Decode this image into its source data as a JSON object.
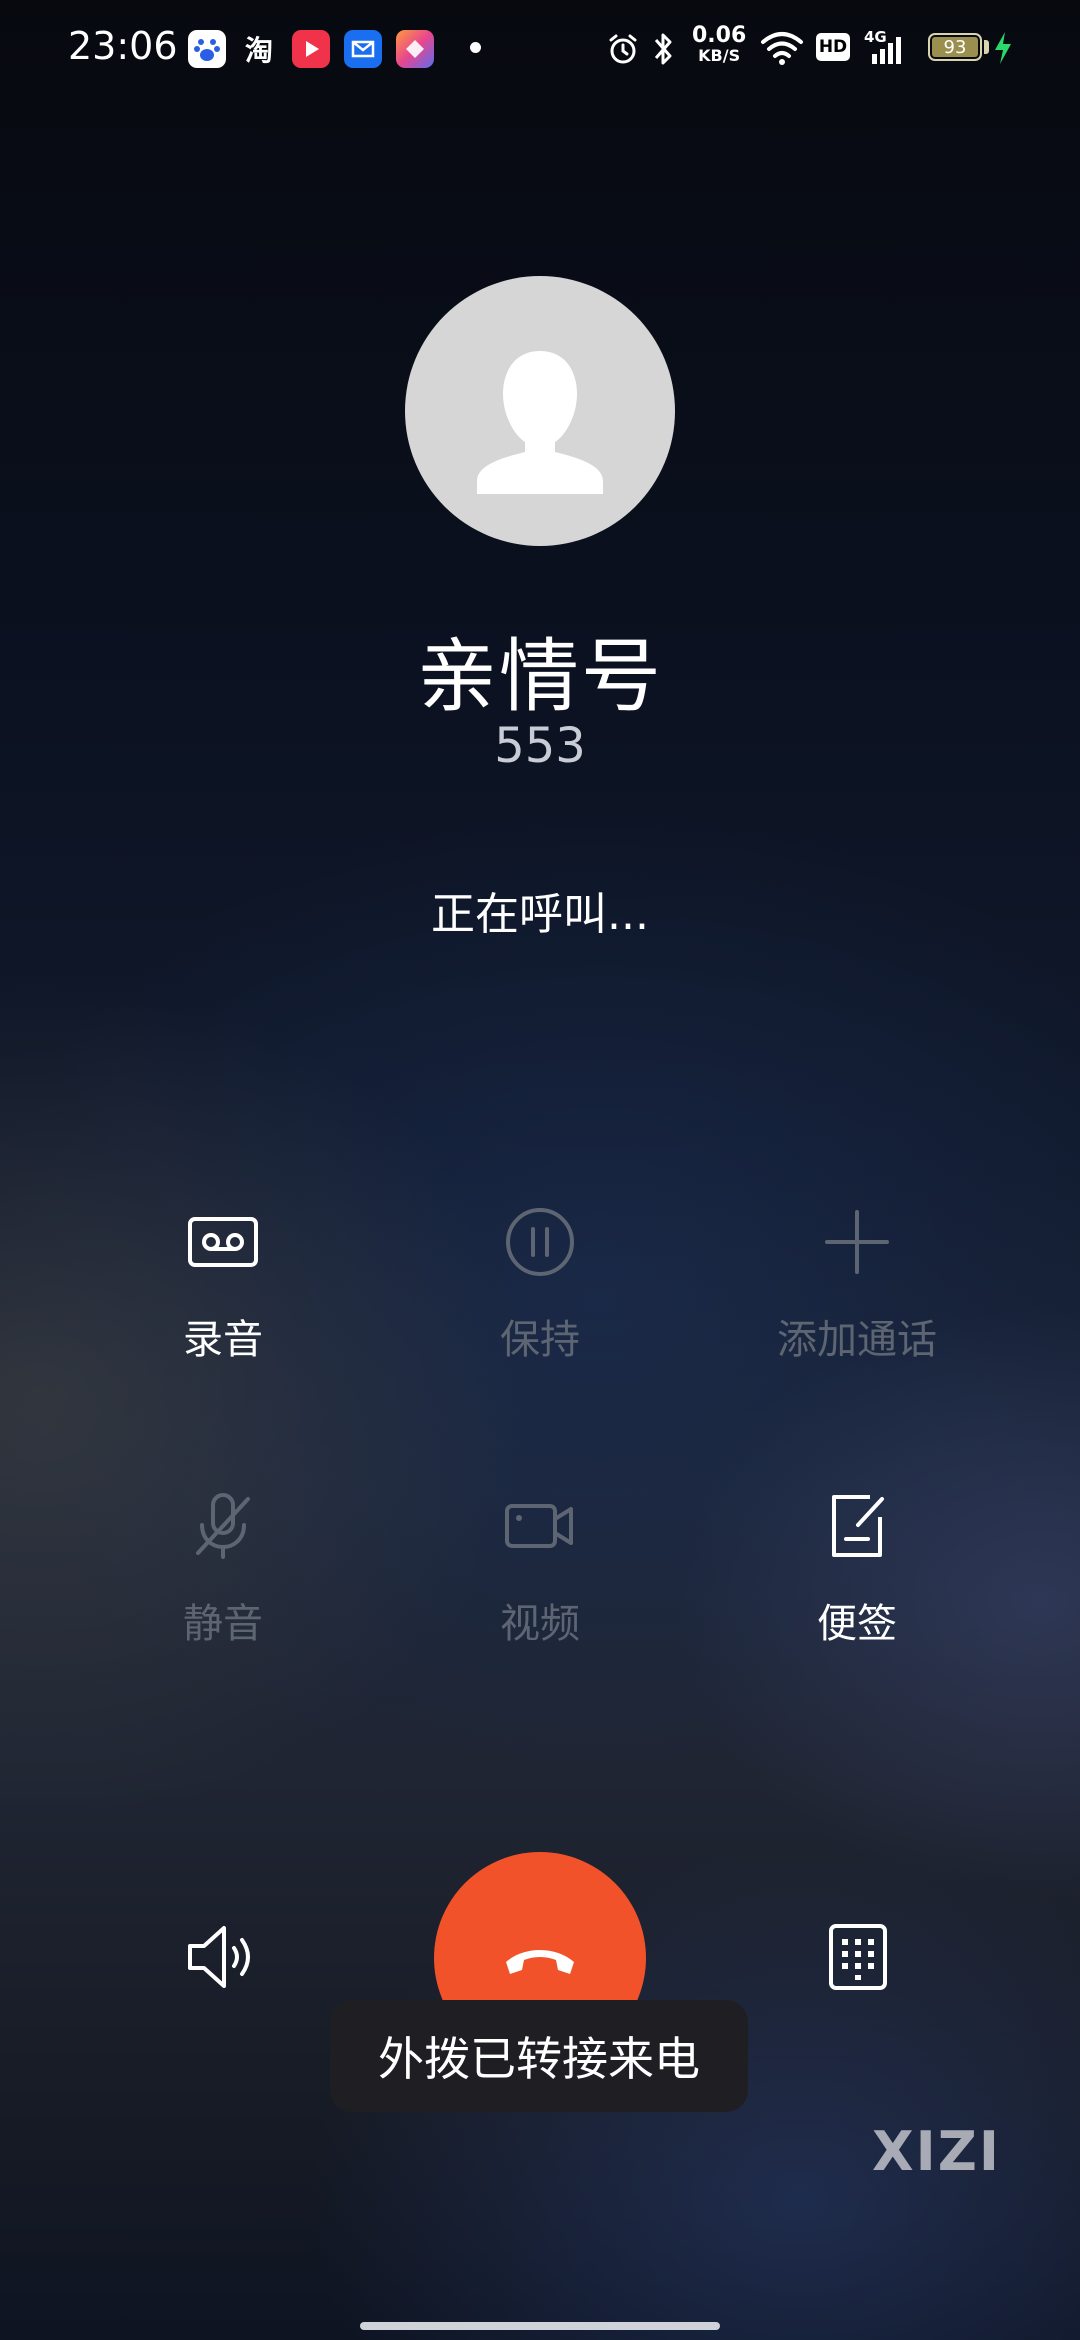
{
  "status_bar": {
    "time": "23:06",
    "net_speed_value": "0.06",
    "net_speed_unit": "KB/S",
    "hd_label": "HD",
    "signal_label": "4G",
    "battery_level": "93",
    "apps": [
      "baidu-app-icon",
      "taobao-app-icon",
      "video-app-icon",
      "mail-app-icon",
      "shortcut-app-icon"
    ],
    "taobao_label": "淘"
  },
  "caller": {
    "name": "亲情号",
    "number": "553",
    "status": "正在呼叫..."
  },
  "controls": {
    "record": "录音",
    "hold": "保持",
    "add_call": "添加通话",
    "mute": "静音",
    "video": "视频",
    "notes": "便签"
  },
  "toast": {
    "message": "外拨已转接来电"
  },
  "watermark": "XIZI",
  "colors": {
    "end_call": "#f1522a",
    "disabled_label": "#5e6572",
    "active_label": "#ffffff"
  }
}
